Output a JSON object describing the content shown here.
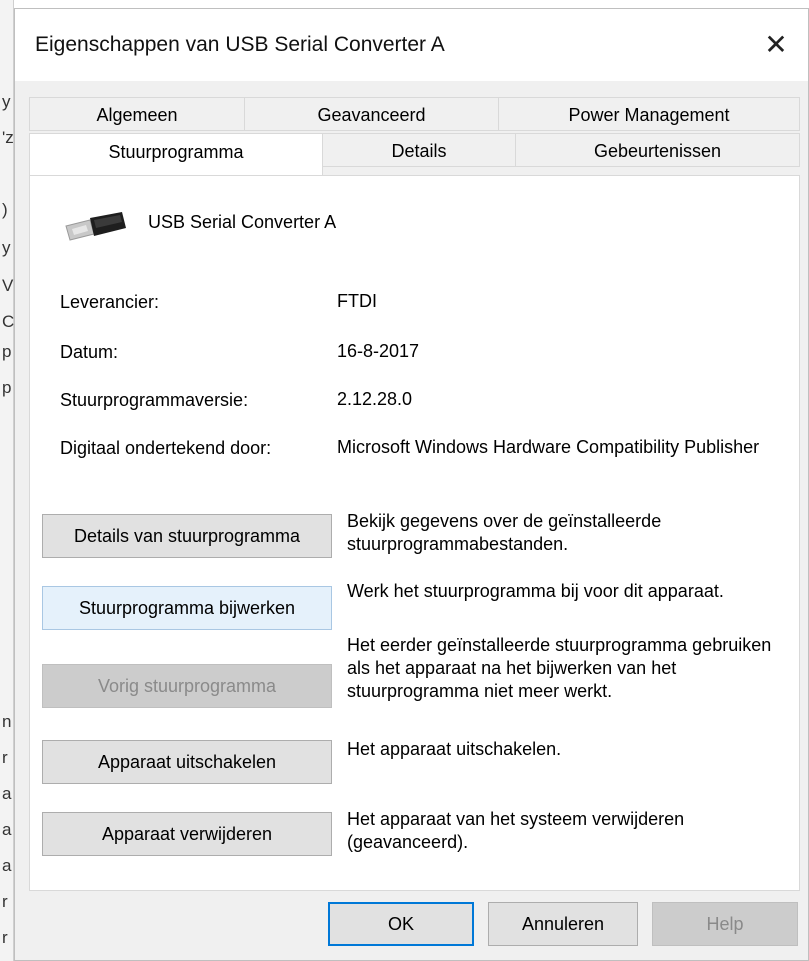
{
  "background": {
    "chars": [
      "y",
      "'z",
      ")",
      "y",
      "V",
      "C",
      "p",
      "p",
      "n",
      "r",
      "a",
      "a",
      "a",
      "r",
      "r"
    ]
  },
  "window": {
    "title": "Eigenschappen van USB Serial Converter A",
    "close_glyph": "✕"
  },
  "tabs": {
    "row1": [
      "Algemeen",
      "Geavanceerd",
      "Power Management"
    ],
    "row2": [
      "Stuurprogramma",
      "Details",
      "Gebeurtenissen"
    ],
    "active": "Stuurprogramma"
  },
  "device": {
    "name": "USB Serial Converter A",
    "icon": "usb-connector-icon"
  },
  "info": {
    "vendor_label": "Leverancier:",
    "vendor_value": "FTDI",
    "date_label": "Datum:",
    "date_value": "16-8-2017",
    "version_label": "Stuurprogrammaversie:",
    "version_value": "2.12.28.0",
    "signer_label": "Digitaal ondertekend door:",
    "signer_value": "Microsoft Windows Hardware Compatibility Publisher"
  },
  "actions": {
    "details_label": "Details van stuurprogramma",
    "details_desc": "Bekijk gegevens over de geïnstalleerde stuurprogrammabestanden.",
    "update_label": "Stuurprogramma bijwerken",
    "update_desc": "Werk het stuurprogramma bij voor dit apparaat.",
    "rollback_label": "Vorig stuurprogramma",
    "rollback_desc": "Het eerder geïnstalleerde stuurprogramma gebruiken als het apparaat na het bijwerken van het stuurprogramma niet meer werkt.",
    "disable_label": "Apparaat uitschakelen",
    "disable_desc": "Het apparaat uitschakelen.",
    "uninstall_label": "Apparaat verwijderen",
    "uninstall_desc": "Het apparaat van het systeem verwijderen (geavanceerd)."
  },
  "footer": {
    "ok": "OK",
    "cancel": "Annuleren",
    "help": "Help"
  },
  "colors": {
    "accent": "#0078d7",
    "dialog_bg": "#f0f0f0",
    "panel_bg": "#ffffff",
    "disabled_text": "#8a8a8a"
  }
}
